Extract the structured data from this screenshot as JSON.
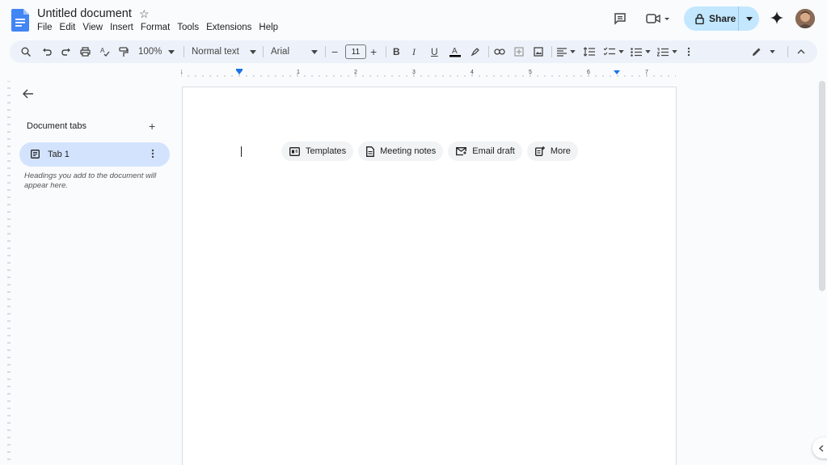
{
  "app": {
    "title": "Untitled document",
    "menu": [
      "File",
      "Edit",
      "View",
      "Insert",
      "Format",
      "Tools",
      "Extensions",
      "Help"
    ]
  },
  "header": {
    "share_label": "Share",
    "icons": [
      "comment-icon",
      "video-call-icon",
      "lock-icon",
      "gemini-icon",
      "avatar"
    ]
  },
  "toolbar": {
    "zoom": "100%",
    "style": "Normal text",
    "font": "Arial",
    "font_size": "11"
  },
  "ruler": {
    "labels": [
      "1",
      "1",
      "2",
      "3",
      "4",
      "5",
      "6",
      "7"
    ]
  },
  "sidebar": {
    "title": "Document tabs",
    "tab_label": "Tab 1",
    "hint": "Headings you add to the document will appear here."
  },
  "chips": [
    {
      "label": "Templates",
      "icon": "template-icon"
    },
    {
      "label": "Meeting notes",
      "icon": "document-icon"
    },
    {
      "label": "Email draft",
      "icon": "email-icon"
    },
    {
      "label": "More",
      "icon": "more-doc-icon"
    }
  ],
  "colors": {
    "accent": "#1a73e8",
    "share_bg": "#c2e7ff",
    "tab_active": "#d3e3fd",
    "toolbar_bg": "#edf2fa"
  }
}
